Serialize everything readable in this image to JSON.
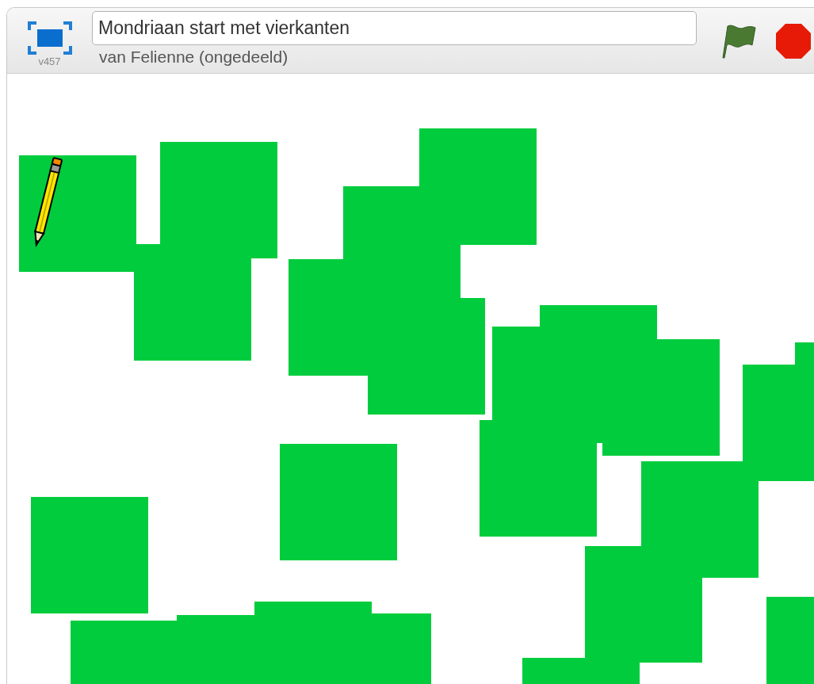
{
  "header": {
    "version": "v457",
    "project_title": "Mondriaan start met vierkanten",
    "byline": "van Felienne (ongedeeld)"
  }
}
